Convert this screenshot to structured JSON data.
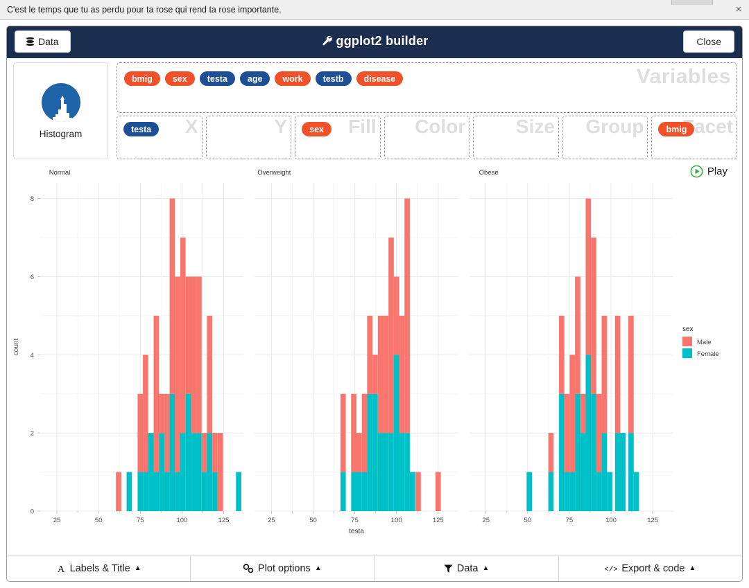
{
  "browser_notice": {
    "message": "C'est le temps que tu as perdu pour ta rose qui rend ta rose importante.",
    "close_label": "×"
  },
  "header": {
    "data_button": "Data",
    "title": "ggplot2 builder",
    "close_button": "Close"
  },
  "geom": {
    "label": "Histogram"
  },
  "variables": {
    "ghost_label": "Variables",
    "chips": [
      {
        "name": "bmig",
        "type": "cat"
      },
      {
        "name": "sex",
        "type": "cat"
      },
      {
        "name": "testa",
        "type": "num"
      },
      {
        "name": "age",
        "type": "num"
      },
      {
        "name": "work",
        "type": "cat"
      },
      {
        "name": "testb",
        "type": "num"
      },
      {
        "name": "disease",
        "type": "cat"
      }
    ]
  },
  "zones": [
    {
      "ghost": "X",
      "chip": {
        "name": "testa",
        "type": "num"
      }
    },
    {
      "ghost": "Y",
      "chip": null
    },
    {
      "ghost": "Fill",
      "chip": {
        "name": "sex",
        "type": "cat"
      }
    },
    {
      "ghost": "Color",
      "chip": null
    },
    {
      "ghost": "Size",
      "chip": null
    },
    {
      "ghost": "Group",
      "chip": null
    },
    {
      "ghost": "Facet",
      "chip": {
        "name": "bmig",
        "type": "cat"
      }
    }
  ],
  "play": {
    "label": "Play"
  },
  "toolbar": [
    {
      "icon": "font-icon",
      "label": "Labels & Title",
      "caret": "▲"
    },
    {
      "icon": "sliders-icon",
      "label": "Plot options",
      "caret": "▲"
    },
    {
      "icon": "filter-icon",
      "label": "Data",
      "caret": "▲"
    },
    {
      "icon": "code-icon",
      "label": "Export & code",
      "caret": "▲"
    }
  ],
  "colors": {
    "header_bg": "#1c2e4f",
    "chip_categorical": "#f05129",
    "chip_numeric": "#1c4f94",
    "male": "#f8766d",
    "female": "#00c0c7",
    "grid": "#ebebeb",
    "play_green": "#2eac3f"
  },
  "chart_data": {
    "type": "bar",
    "title": "",
    "xlabel": "testa",
    "ylabel": "count",
    "ylim": [
      0,
      8.4
    ],
    "yticks": [
      0,
      2,
      4,
      6,
      8
    ],
    "xticks": [
      25,
      50,
      75,
      100,
      125
    ],
    "xlim": [
      15,
      137
    ],
    "grid": true,
    "stacked": true,
    "bin_width": 3.2,
    "legend": {
      "title": "sex",
      "position": "right",
      "entries": [
        {
          "label": "Male",
          "color": "#f8766d"
        },
        {
          "label": "Female",
          "color": "#00c0c7"
        }
      ]
    },
    "facets": [
      {
        "label": "Normal",
        "bins": [
          {
            "x": 62.0,
            "Male": 1,
            "Female": 0
          },
          {
            "x": 68.4,
            "Male": 0,
            "Female": 1
          },
          {
            "x": 75.0,
            "Male": 2,
            "Female": 1
          },
          {
            "x": 78.2,
            "Male": 3,
            "Female": 1
          },
          {
            "x": 81.4,
            "Male": 0,
            "Female": 2
          },
          {
            "x": 84.6,
            "Male": 4,
            "Female": 1
          },
          {
            "x": 87.8,
            "Male": 1,
            "Female": 2
          },
          {
            "x": 91.0,
            "Male": 2,
            "Female": 1
          },
          {
            "x": 94.2,
            "Male": 5,
            "Female": 3
          },
          {
            "x": 97.4,
            "Male": 5,
            "Female": 1
          },
          {
            "x": 100.6,
            "Male": 5,
            "Female": 2
          },
          {
            "x": 103.8,
            "Male": 3,
            "Female": 3
          },
          {
            "x": 107.0,
            "Male": 4,
            "Female": 2
          },
          {
            "x": 110.2,
            "Male": 4,
            "Female": 2
          },
          {
            "x": 113.4,
            "Male": 1,
            "Female": 1
          },
          {
            "x": 116.6,
            "Male": 3,
            "Female": 2
          },
          {
            "x": 119.8,
            "Male": 1,
            "Female": 1
          },
          {
            "x": 123.0,
            "Male": 2,
            "Female": 0
          },
          {
            "x": 134.0,
            "Male": 0,
            "Female": 1
          }
        ]
      },
      {
        "label": "Overweight",
        "bins": [
          {
            "x": 68.0,
            "Male": 2,
            "Female": 1
          },
          {
            "x": 74.4,
            "Male": 2,
            "Female": 1
          },
          {
            "x": 77.6,
            "Male": 1,
            "Female": 1
          },
          {
            "x": 80.8,
            "Male": 2,
            "Female": 1
          },
          {
            "x": 84.0,
            "Male": 2,
            "Female": 3
          },
          {
            "x": 87.2,
            "Male": 1,
            "Female": 3
          },
          {
            "x": 90.4,
            "Male": 3,
            "Female": 2
          },
          {
            "x": 93.6,
            "Male": 3,
            "Female": 2
          },
          {
            "x": 96.8,
            "Male": 5,
            "Female": 2
          },
          {
            "x": 100.0,
            "Male": 2,
            "Female": 4
          },
          {
            "x": 103.2,
            "Male": 3,
            "Female": 2
          },
          {
            "x": 106.4,
            "Male": 6,
            "Female": 2
          },
          {
            "x": 109.6,
            "Male": 0,
            "Female": 1
          },
          {
            "x": 113.0,
            "Male": 1,
            "Female": 0
          },
          {
            "x": 125.0,
            "Male": 1,
            "Female": 0
          }
        ]
      },
      {
        "label": "Obese",
        "bins": [
          {
            "x": 51.0,
            "Male": 0,
            "Female": 1
          },
          {
            "x": 64.0,
            "Male": 1,
            "Female": 1
          },
          {
            "x": 70.4,
            "Male": 2,
            "Female": 3
          },
          {
            "x": 73.6,
            "Male": 2,
            "Female": 1
          },
          {
            "x": 76.8,
            "Male": 3,
            "Female": 1
          },
          {
            "x": 80.0,
            "Male": 3,
            "Female": 3
          },
          {
            "x": 83.2,
            "Male": 1,
            "Female": 2
          },
          {
            "x": 86.4,
            "Male": 4,
            "Female": 4
          },
          {
            "x": 89.6,
            "Male": 4,
            "Female": 3
          },
          {
            "x": 92.8,
            "Male": 2,
            "Female": 1
          },
          {
            "x": 96.0,
            "Male": 3,
            "Female": 2
          },
          {
            "x": 99.2,
            "Male": 0,
            "Female": 1
          },
          {
            "x": 104.0,
            "Male": 3,
            "Female": 2
          },
          {
            "x": 107.2,
            "Male": 0,
            "Female": 2
          },
          {
            "x": 112.0,
            "Male": 3,
            "Female": 2
          },
          {
            "x": 115.2,
            "Male": 0,
            "Female": 1
          }
        ]
      }
    ]
  }
}
